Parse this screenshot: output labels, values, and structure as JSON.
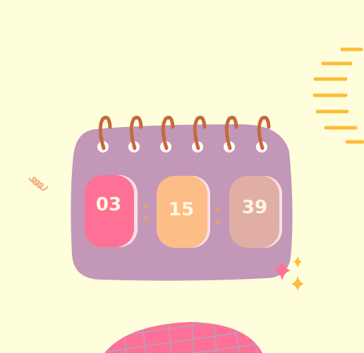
{
  "clock": {
    "hours": "03",
    "minutes": "15",
    "seconds": "39"
  },
  "colors": {
    "background": "#fffedc",
    "calendar": "#c397b8",
    "hours_box": "#ff7096",
    "minutes_box": "#fdbd87",
    "seconds_box": "#e0aea4",
    "rings": "#c46a3c",
    "lines": "#fbbd3a"
  }
}
